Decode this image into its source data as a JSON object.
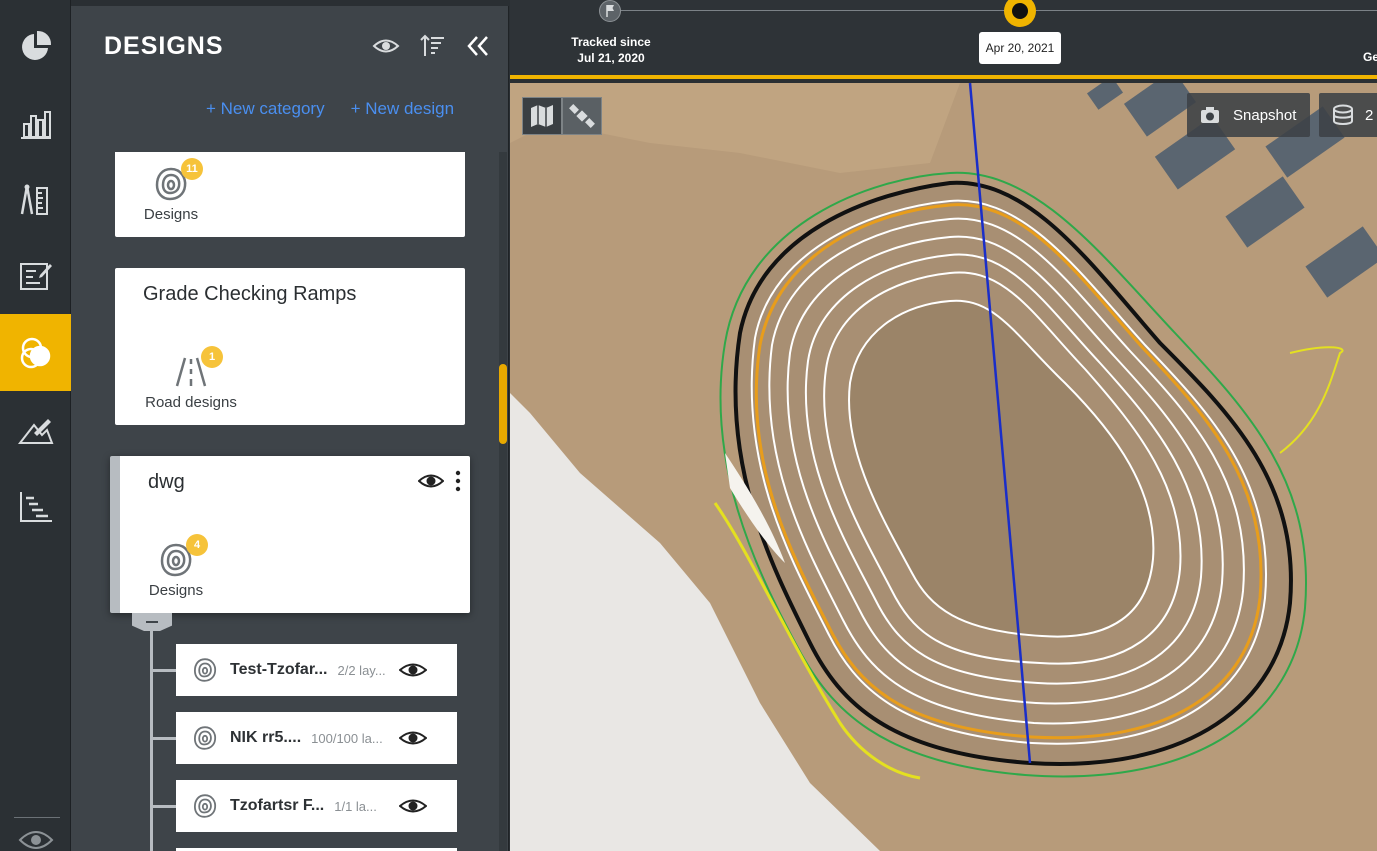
{
  "rail": {
    "items": [
      {
        "name": "pie-chart-icon"
      },
      {
        "name": "bar-chart-icon"
      },
      {
        "name": "measure-tools-icon"
      },
      {
        "name": "report-icon"
      },
      {
        "name": "designs-layers-icon"
      },
      {
        "name": "terrain-icon"
      },
      {
        "name": "gantt-chart-icon"
      }
    ],
    "active_index": 4,
    "accent": "#f0b400"
  },
  "panel": {
    "title": "DESIGNS",
    "new_category": "+ New category",
    "new_design": "+ New design",
    "link_color": "#4a8ff0"
  },
  "cards": [
    {
      "title": "",
      "item_label": "Designs",
      "item_icon": "contour-icon",
      "badge": "11"
    },
    {
      "title": "Grade Checking Ramps",
      "item_label": "Road designs",
      "item_icon": "road-icon",
      "badge": "1"
    },
    {
      "title": "dwg",
      "item_label": "Designs",
      "item_icon": "contour-icon",
      "badge": "4"
    }
  ],
  "designs": [
    {
      "name": "Test-Tzofar...",
      "count": "2/2 lay..."
    },
    {
      "name": "NIK rr5....",
      "count": "100/100 la..."
    },
    {
      "name": "Tzofartsr F...",
      "count": "1/1 la..."
    }
  ],
  "timeline": {
    "tracked_label": "Tracked since",
    "tracked_date": "Jul 21, 2020",
    "current_date": "Apr 20, 2021",
    "cut_label": "Ge"
  },
  "map": {
    "snapshot_label": "Snapshot",
    "view3d_label": "2"
  }
}
